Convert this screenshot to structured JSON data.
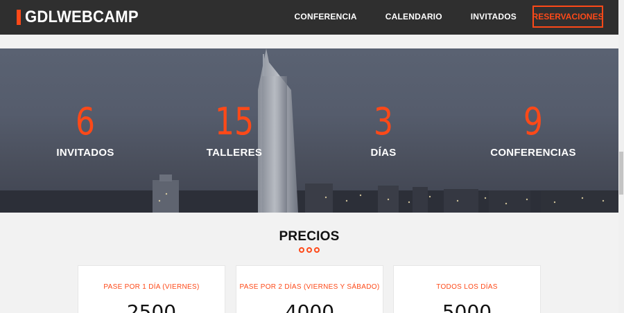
{
  "header": {
    "logo_text": "GDLWEBCAMP",
    "nav": [
      "CONFERENCIA",
      "CALENDARIO",
      "INVITADOS"
    ],
    "cta_label": "RESERVACIONES",
    "accent_color": "#fe4918"
  },
  "stats": [
    {
      "value": "6",
      "label": "INVITADOS"
    },
    {
      "value": "15",
      "label": "TALLERES"
    },
    {
      "value": "3",
      "label": "DÍAS"
    },
    {
      "value": "9",
      "label": "CONFERENCIAS"
    }
  ],
  "prices": {
    "title": "PRECIOS",
    "cards": [
      {
        "title": "PASE POR 1 DÍA (VIERNES)",
        "price": "2500"
      },
      {
        "title": "PASE POR 2 DÍAS (VIERNES Y SÁBADO)",
        "price": "4000"
      },
      {
        "title": "TODOS LOS DÍAS",
        "price": "5000"
      }
    ]
  }
}
